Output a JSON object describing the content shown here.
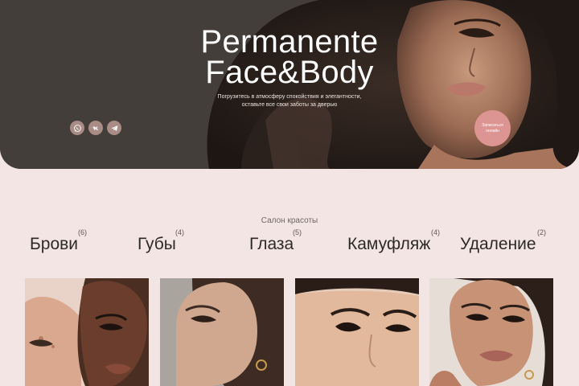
{
  "hero": {
    "title_line1": "Permanente",
    "title_line2": "Face&Body",
    "subtitle_line1": "Погрузитесь в атмосферу спокойствия и элегантности,",
    "subtitle_line2": "оставьте все свои заботы за дверью",
    "book_button": "Записаться онлайн",
    "socials": [
      {
        "icon": "whatsapp-icon"
      },
      {
        "icon": "vk-icon"
      },
      {
        "icon": "telegram-icon"
      }
    ]
  },
  "section": {
    "label": "Салон красоты",
    "categories": [
      {
        "name": "Брови",
        "count": "(6)"
      },
      {
        "name": "Губы",
        "count": "(4)"
      },
      {
        "name": "Глаза",
        "count": "(5)"
      },
      {
        "name": "Камуфляж",
        "count": "(4)"
      },
      {
        "name": "Удаление",
        "count": "(2)"
      }
    ]
  },
  "colors": {
    "page_bg": "#f3e5e4",
    "hero_bg": "#433e3a",
    "accent": "#dc9593",
    "social_bg": "#a88c85"
  }
}
